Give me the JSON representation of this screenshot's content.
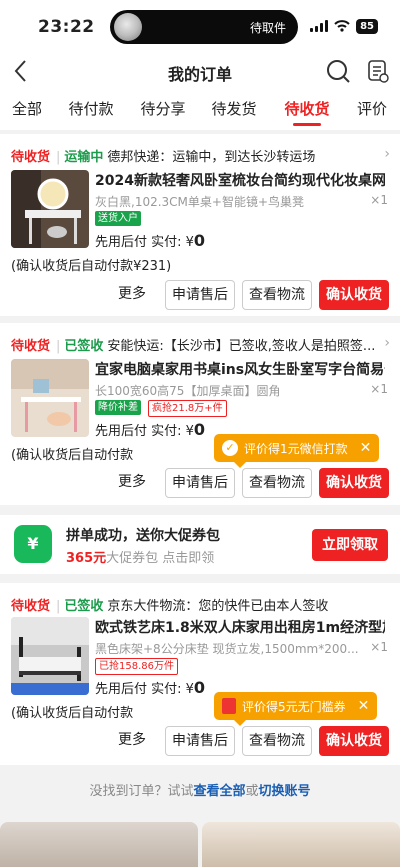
{
  "status_bar": {
    "time": "23:22",
    "pickup": "待取件",
    "battery": "85"
  },
  "nav": {
    "title": "我的订单"
  },
  "tabs": [
    "全部",
    "待付款",
    "待分享",
    "待发货",
    "待收货",
    "评价"
  ],
  "active_tab": "待收货",
  "orders": [
    {
      "status": "待收货",
      "logistics_status": "运输中",
      "carrier_info": "德邦快递：运输中，到达长沙转运场",
      "product_name": "2024新款轻奢风卧室梳妆台简约现代化妆桌网红i",
      "spec": "灰白黑,102.3CM单桌+智能镜+鸟巢凳",
      "quantity": "×1",
      "tags": [
        "送货入户"
      ],
      "pay_label": "先用后付 实付: ¥",
      "pay_amount": "0",
      "auto_pay": "(确认收货后自动付款¥231)",
      "buttons": {
        "more": "更多",
        "after_sale": "申请售后",
        "logistics": "查看物流",
        "confirm": "确认收货"
      }
    },
    {
      "status": "待收货",
      "logistics_status": "已签收",
      "carrier_info": "安能快运:【长沙市】已签收,签收人是拍照签...",
      "product_name": "宜家电脑桌家用书桌ins风女生卧室写字台简易长",
      "spec": "长100宽60高75【加厚桌面】圆角",
      "quantity": "×1",
      "tags": [
        "降价补差",
        "疯抢21.8万+件"
      ],
      "pay_label": "先用后付 实付: ¥",
      "pay_amount": "0",
      "auto_pay": "(确认收货后自动付款",
      "tip": "评价得1元微信打款",
      "buttons": {
        "more": "更多",
        "after_sale": "申请售后",
        "logistics": "查看物流",
        "confirm": "确认收货"
      }
    },
    {
      "status": "待收货",
      "logistics_status": "已签收",
      "carrier_info": "京东大件物流：您的快件已由本人签收",
      "product_name": "欧式铁艺床1.8米双人床家用出租房1m经济型加",
      "spec": "黑色床架+8公分床垫 现货立发,1500mm*200...",
      "quantity": "×1",
      "tags": [
        "已抢158.86万件"
      ],
      "pay_label": "先用后付 实付: ¥",
      "pay_amount": "0",
      "auto_pay": "(确认收货后自动付款",
      "tip": "评价得5元无门槛券",
      "buttons": {
        "more": "更多",
        "after_sale": "申请售后",
        "logistics": "查看物流",
        "confirm": "确认收货"
      }
    }
  ],
  "promo": {
    "icon": "¥",
    "title": "拼单成功，送你大促券包",
    "amount": "365元",
    "desc": "大促券包 点击即领",
    "button": "立即领取"
  },
  "footer": {
    "prefix": "没找到订单？试试",
    "link1": "查看全部",
    "mid": "或",
    "link2": "切换账号"
  },
  "icons": [
    "back-arrow-icon",
    "search-icon",
    "order-more-icon",
    "chevron-right-icon",
    "check-circle-icon",
    "close-icon",
    "red-packet-icon"
  ],
  "colors": {
    "accent": "#e22222",
    "green": "#1b9b4b",
    "tip": "#f7a100"
  }
}
